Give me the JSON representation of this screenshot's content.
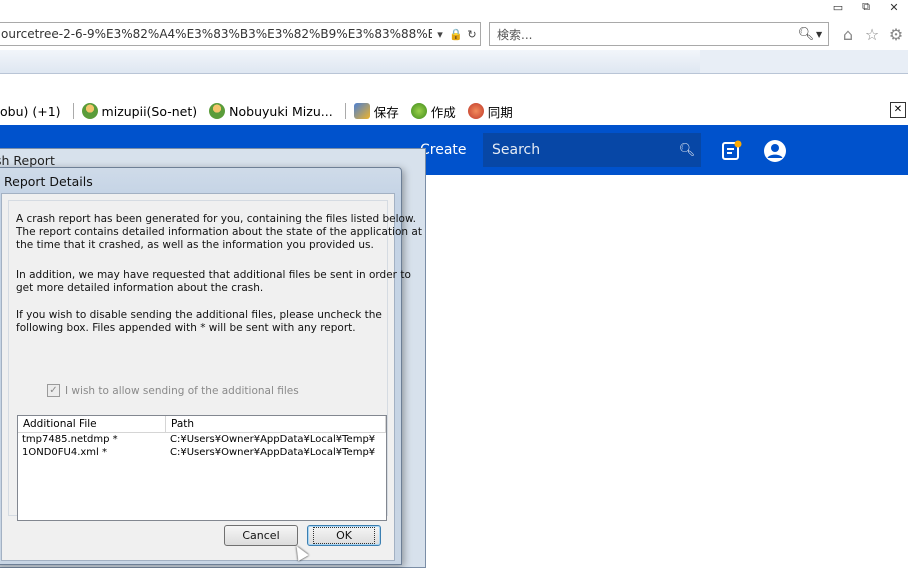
{
  "browser": {
    "window_controls": [
      "▭",
      "⧉",
      "✕"
    ],
    "address_text": "ourcetree-2-6-9%E3%82%A4%E3%83%B3%E3%82%B9%E3%83%88%E3",
    "address_icons": [
      "▾",
      "🔒",
      "↻"
    ],
    "search_placeholder": "検索...",
    "nav_icons": [
      "⌂",
      "☆",
      "⚙"
    ]
  },
  "favorites": {
    "items": [
      {
        "label": "obu) (+1)"
      },
      {
        "label": "mizupii(So-net)"
      },
      {
        "label": "Nobuyuki Mizu..."
      },
      {
        "label": "保存"
      },
      {
        "label": "作成"
      },
      {
        "label": "同期"
      }
    ],
    "close_glyph": "✕"
  },
  "site": {
    "create_label": "Create",
    "search_label": "Search"
  },
  "back_window": {
    "title": "sh Report"
  },
  "dialog": {
    "title": "Report Details",
    "para1": [
      "A crash report has been generated for you, containing the files listed below.",
      "The report contains detailed information about the state of the application at",
      "the time that it crashed, as well as the information you provided us."
    ],
    "para2": [
      "In addition, we may have requested that additional files be sent in order to",
      "get more detailed information about the crash."
    ],
    "para3": [
      "If you wish to disable sending the additional files, please uncheck the",
      "following box.  Files appended with * will be sent with any report."
    ],
    "checkbox_label": "I wish to allow sending of the additional files",
    "checkbox_checked": true,
    "columns": [
      "Additional File",
      "Path"
    ],
    "files": [
      {
        "name": "tmp7485.netdmp *",
        "path": "C:¥Users¥Owner¥AppData¥Local¥Temp¥"
      },
      {
        "name": "1OND0FU4.xml *",
        "path": "C:¥Users¥Owner¥AppData¥Local¥Temp¥"
      }
    ],
    "cancel_label": "Cancel",
    "ok_label": "OK"
  },
  "colors": {
    "site_header": "#0052cc",
    "site_search_bg": "#0747a6"
  }
}
